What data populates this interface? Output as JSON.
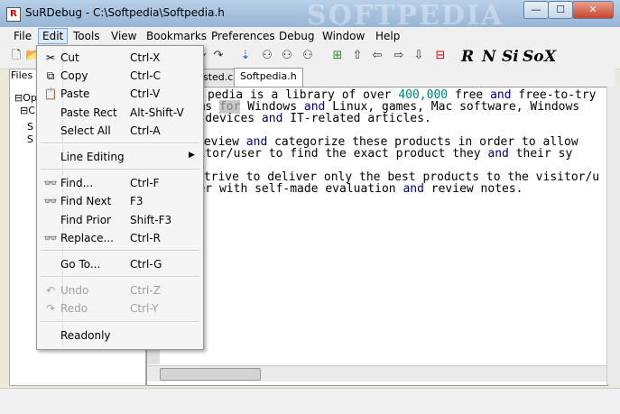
{
  "window": {
    "title": "SuRDebug - C:\\Softpedia\\Softpedia.h",
    "watermark": "SOFTPEDIA",
    "app_icon": "R",
    "minimize": "—",
    "maximize": "☐",
    "close": "✕"
  },
  "menubar": [
    "File",
    "Edit",
    "Tools",
    "View",
    "Bookmarks",
    "Preferences",
    "Debug",
    "Window",
    "Help"
  ],
  "toolbar": {
    "icons": [
      "new-file-icon",
      "open-folder-icon",
      "cut-icon",
      "copy-icon",
      "paste-icon",
      "undo-icon",
      "redo-icon",
      "step-into-icon",
      "find-icon",
      "find-next-icon",
      "add-bookmark-icon",
      "arrow-up-icon",
      "arrow-left-icon",
      "arrow-right-icon",
      "arrow-down-icon",
      "remove-bookmark-icon"
    ],
    "letter_buttons": [
      "R",
      "N",
      "Si",
      "So",
      "X"
    ]
  },
  "left_panel": {
    "tab": "Files",
    "tree": [
      "Ope",
      "C:",
      "S",
      "S"
    ]
  },
  "tabs": [
    "sted.c",
    "Softpedia.h"
  ],
  "editor_lines": [
    [
      {
        "t": "pedia is a library of over "
      },
      {
        "t": "400,000",
        "c": "num"
      },
      {
        "t": " free "
      },
      {
        "t": "and",
        "c": "kw"
      },
      {
        "t": " free-to-try"
      }
    ],
    [
      {
        "t": "grams "
      },
      {
        "t": "for",
        "c": "hl"
      },
      {
        "t": " Windows "
      },
      {
        "t": "and",
        "c": "kw"
      },
      {
        "t": " Linux, games, Mac software, Windows"
      }
    ],
    [
      {
        "t": "ile devices "
      },
      {
        "t": "and",
        "c": "kw"
      },
      {
        "t": " IT-related articles."
      }
    ],
    [],
    [
      {
        "t": "review "
      },
      {
        "t": "and",
        "c": "kw"
      },
      {
        "t": " categorize these products in order to allow"
      }
    ],
    [
      {
        "t": "visitor/user to find the exact product they "
      },
      {
        "t": "and",
        "c": "kw"
      },
      {
        "t": " their sy"
      }
    ],
    [],
    [
      {
        "t": "strive to deliver only the best products to the visitor/u"
      }
    ],
    [
      {
        "t": "ether with self-made evaluation "
      },
      {
        "t": "and",
        "c": "kw"
      },
      {
        "t": " review notes."
      }
    ]
  ],
  "edit_menu": {
    "items": [
      {
        "label": "Cut",
        "shortcut": "Ctrl-X",
        "icon": "scissors-icon",
        "glyph": "✂",
        "enabled": true
      },
      {
        "label": "Copy",
        "shortcut": "Ctrl-C",
        "icon": "copy-icon",
        "glyph": "⧉",
        "enabled": true
      },
      {
        "label": "Paste",
        "shortcut": "Ctrl-V",
        "icon": "paste-icon",
        "glyph": "📋",
        "enabled": true
      },
      {
        "label": "Paste Rect",
        "shortcut": "Alt-Shift-V",
        "icon": "",
        "glyph": "",
        "enabled": true
      },
      {
        "label": "Select All",
        "shortcut": "Ctrl-A",
        "icon": "",
        "glyph": "",
        "enabled": true
      },
      {
        "sep": true
      },
      {
        "label": "Line Editing",
        "shortcut": "",
        "submenu": true,
        "icon": "",
        "glyph": "",
        "enabled": true
      },
      {
        "sep": true
      },
      {
        "label": "Find...",
        "shortcut": "Ctrl-F",
        "icon": "binoculars-icon",
        "glyph": "👓",
        "enabled": true
      },
      {
        "label": "Find Next",
        "shortcut": "F3",
        "icon": "binoculars-icon",
        "glyph": "👓",
        "enabled": true
      },
      {
        "label": "Find Prior",
        "shortcut": "Shift-F3",
        "icon": "",
        "glyph": "",
        "enabled": true
      },
      {
        "label": "Replace...",
        "shortcut": "Ctrl-R",
        "icon": "binoculars-icon",
        "glyph": "👓",
        "enabled": true
      },
      {
        "sep": true
      },
      {
        "label": "Go To...",
        "shortcut": "Ctrl-G",
        "icon": "",
        "glyph": "",
        "enabled": true
      },
      {
        "sep": true
      },
      {
        "label": "Undo",
        "shortcut": "Ctrl-Z",
        "icon": "undo-icon",
        "glyph": "↶",
        "enabled": false
      },
      {
        "label": "Redo",
        "shortcut": "Ctrl-Y",
        "icon": "redo-icon",
        "glyph": "↷",
        "enabled": false
      },
      {
        "sep": true
      },
      {
        "label": "Readonly",
        "shortcut": "",
        "icon": "",
        "glyph": "",
        "enabled": true
      }
    ]
  },
  "colors": {
    "keyword": "#000080",
    "number": "#008080",
    "selection": "#c8c8c8"
  }
}
